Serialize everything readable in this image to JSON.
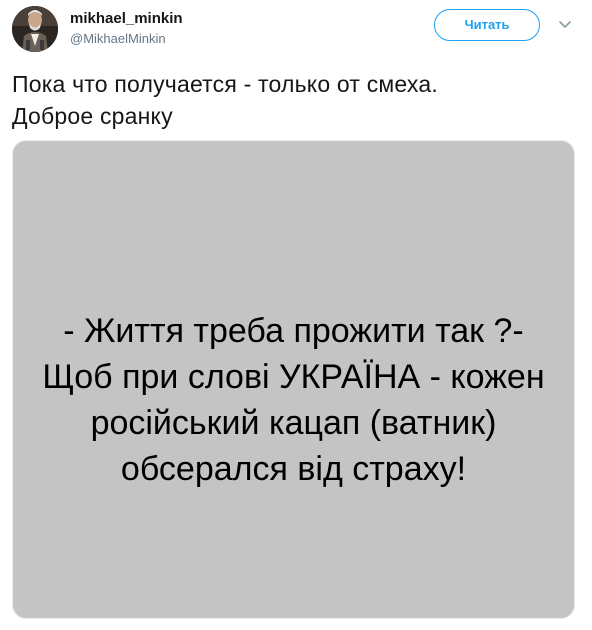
{
  "author": {
    "display_name": "mikhael_minkin",
    "handle": "@MikhaelMinkin",
    "avatar_icon": "person-photo-avatar"
  },
  "header": {
    "follow_label": "Читать",
    "menu_icon": "chevron-down-icon",
    "accent_color": "#1da1f2"
  },
  "tweet": {
    "text_lines": [
      "Пока что получается - только от смеха.",
      "Доброе сранку"
    ]
  },
  "media": {
    "background_color": "#c4c4c4",
    "lines": [
      "- Життя треба прожити так ?-",
      "Щоб при слові УКРАЇНА - кожен",
      "російський кацап (ватник)",
      "обсерался від страху!"
    ]
  }
}
